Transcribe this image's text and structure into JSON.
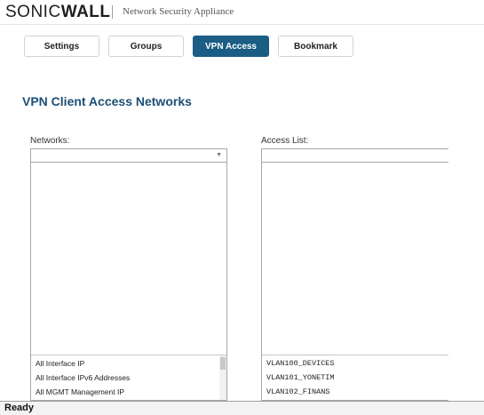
{
  "header": {
    "logo_sonic": "SONIC",
    "logo_wall": "WALL",
    "app_title": "Network Security Appliance"
  },
  "tabs": [
    {
      "label": "Settings",
      "active": false
    },
    {
      "label": "Groups",
      "active": false
    },
    {
      "label": "VPN Access",
      "active": true
    },
    {
      "label": "Bookmark",
      "active": false
    }
  ],
  "page_title": "VPN Client Access Networks",
  "networks": {
    "label": "Networks:",
    "selected": "",
    "items": [
      "All Interface IP",
      "All Interface IPv6 Addresses",
      "All MGMT Management IP"
    ]
  },
  "access_list": {
    "label": "Access List:",
    "selected": "",
    "items": [
      "VLAN100_DEVICES",
      "VLAN101_YONETIM",
      "VLAN102_FINANS"
    ]
  },
  "status": "Ready",
  "colors": {
    "accent": "#1b5d84",
    "title": "#1b4f76"
  }
}
